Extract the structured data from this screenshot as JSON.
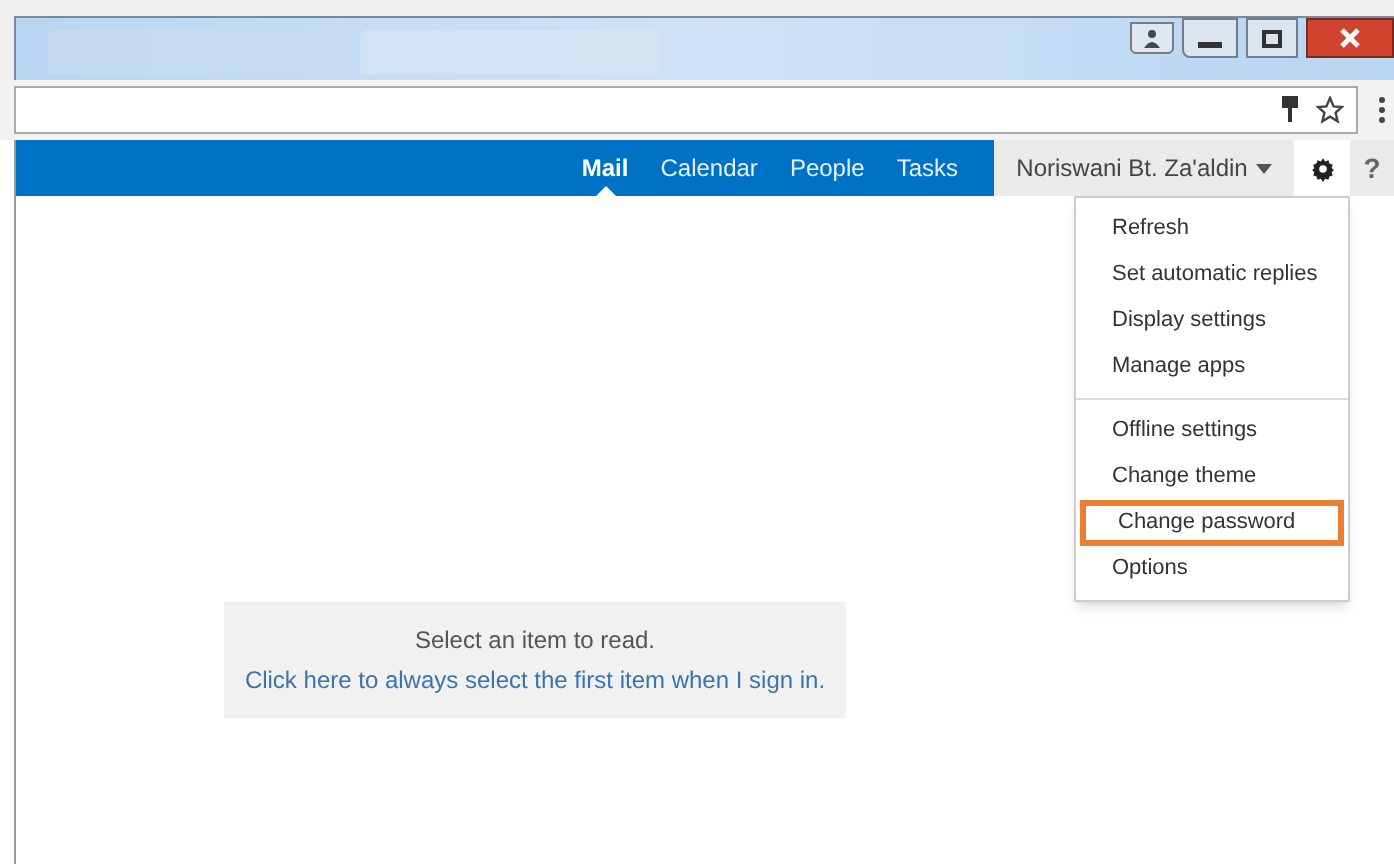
{
  "nav": {
    "tabs": [
      {
        "label": "Mail",
        "selected": true
      },
      {
        "label": "Calendar",
        "selected": false
      },
      {
        "label": "People",
        "selected": false
      },
      {
        "label": "Tasks",
        "selected": false
      }
    ],
    "user": "Noriswani Bt. Za'aldin",
    "help": "?"
  },
  "settings_menu": {
    "sections": [
      {
        "items": [
          {
            "label": "Refresh",
            "highlighted": false
          },
          {
            "label": "Set automatic replies",
            "highlighted": false
          },
          {
            "label": "Display settings",
            "highlighted": false
          },
          {
            "label": "Manage apps",
            "highlighted": false
          }
        ]
      },
      {
        "items": [
          {
            "label": "Offline settings",
            "highlighted": false
          },
          {
            "label": "Change theme",
            "highlighted": false
          },
          {
            "label": "Change password",
            "highlighted": true
          },
          {
            "label": "Options",
            "highlighted": false
          }
        ]
      }
    ]
  },
  "reading_pane": {
    "message": "Select an item to read.",
    "link": "Click here to always select the first item when I sign in."
  }
}
